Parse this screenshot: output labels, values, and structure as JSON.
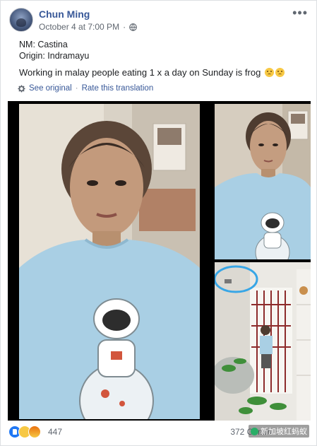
{
  "post": {
    "author": "Chun Ming",
    "date": "October 4 at 7:00 PM",
    "separator": "·",
    "more_label": "•••",
    "lines": [
      "NM: Castina",
      "Origin: Indramayu",
      "Working in malay people eating 1 x a day on Sunday is frog"
    ],
    "translation": {
      "see_original": "See original",
      "separator": "·",
      "rate": "Rate this translation"
    }
  },
  "footer": {
    "reaction_icons": [
      "like-icon",
      "sad-icon",
      "angry-icon"
    ],
    "reaction_count": "447",
    "comments": "372 Comm",
    "watermark": "新加坡红蚂蚁"
  },
  "colors": {
    "link": "#385898",
    "meta": "#606770",
    "photo_bg": "#000000",
    "shirt": "#a9cfe4"
  }
}
